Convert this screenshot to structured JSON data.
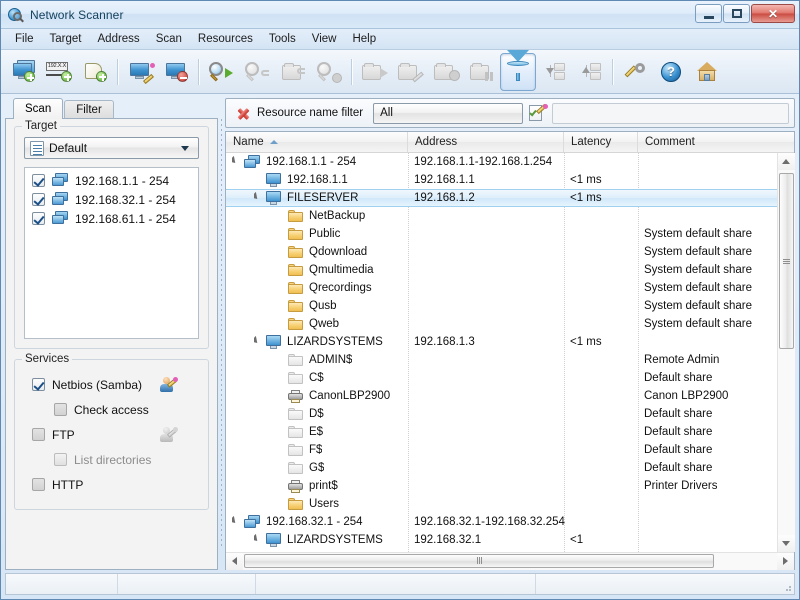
{
  "window": {
    "title": "Network Scanner",
    "app_icon": "network-scanner-icon",
    "minimize_label": "",
    "maximize_label": "",
    "close_label": "✕"
  },
  "menubar": {
    "items": [
      {
        "label": "File"
      },
      {
        "label": "Target"
      },
      {
        "label": "Address"
      },
      {
        "label": "Scan"
      },
      {
        "label": "Resources"
      },
      {
        "label": "Tools"
      },
      {
        "label": "View"
      },
      {
        "label": "Help"
      }
    ]
  },
  "toolbar": {
    "buttons": [
      {
        "name": "add-computer-button",
        "icon": "computer-add-icon",
        "enabled": true,
        "pressed": false
      },
      {
        "name": "add-ip-range-button",
        "icon": "ip-range-add-icon",
        "enabled": true,
        "pressed": false,
        "ip_text": "192.X.X"
      },
      {
        "name": "add-list-button",
        "icon": "list-add-icon",
        "enabled": true,
        "pressed": false
      },
      {
        "name": "edit-computer-button",
        "icon": "computer-edit-icon",
        "enabled": true,
        "pressed": false
      },
      {
        "name": "delete-computer-button",
        "icon": "computer-delete-icon",
        "enabled": true,
        "pressed": false
      },
      {
        "name": "start-scan-button",
        "icon": "scan-start-icon",
        "enabled": true,
        "pressed": false
      },
      {
        "name": "rescan-button",
        "icon": "scan-rescan-icon",
        "enabled": false,
        "pressed": false
      },
      {
        "name": "scan-folder-button",
        "icon": "scan-folder-icon",
        "enabled": false,
        "pressed": false
      },
      {
        "name": "stop-scan-button",
        "icon": "scan-stop-icon",
        "enabled": false,
        "pressed": false
      },
      {
        "name": "open-resource-button",
        "icon": "folder-open-icon",
        "enabled": false,
        "pressed": false
      },
      {
        "name": "edit-resource-button",
        "icon": "folder-edit-icon",
        "enabled": false,
        "pressed": false
      },
      {
        "name": "remove-resource-button",
        "icon": "folder-remove-icon",
        "enabled": false,
        "pressed": false
      },
      {
        "name": "map-resource-button",
        "icon": "folder-map-icon",
        "enabled": false,
        "pressed": false
      },
      {
        "name": "filter-button",
        "icon": "funnel-filter-icon",
        "enabled": true,
        "pressed": true
      },
      {
        "name": "collapse-all-button",
        "icon": "tree-collapse-icon",
        "enabled": false,
        "pressed": false
      },
      {
        "name": "expand-all-button",
        "icon": "tree-expand-icon",
        "enabled": false,
        "pressed": false
      },
      {
        "name": "options-button",
        "icon": "wrench-options-icon",
        "enabled": true,
        "pressed": false
      },
      {
        "name": "help-button",
        "icon": "help-question-icon",
        "enabled": true,
        "pressed": false
      },
      {
        "name": "home-button",
        "icon": "home-icon",
        "enabled": true,
        "pressed": false
      }
    ]
  },
  "left_panel": {
    "tabs": [
      {
        "label": "Scan",
        "active": true
      },
      {
        "label": "Filter",
        "active": false
      }
    ],
    "target_group": {
      "legend": "Target",
      "profile_combo": {
        "value": "Default",
        "icon": "document-list-icon"
      },
      "targets": [
        {
          "label": "192.168.1.1 - 254",
          "checked": true
        },
        {
          "label": "192.168.32.1 - 254",
          "checked": true
        },
        {
          "label": "192.168.61.1 - 254",
          "checked": true
        }
      ]
    },
    "services_group": {
      "legend": "Services",
      "items": [
        {
          "label": "Netbios (Samba)",
          "checked": true,
          "enabled": true,
          "indent": false,
          "icon": "user-credentials-icon",
          "icon_enabled": true
        },
        {
          "label": "Check access",
          "checked": false,
          "enabled": true,
          "indent": true,
          "icon": null,
          "icon_enabled": false
        },
        {
          "label": "FTP",
          "checked": false,
          "enabled": true,
          "indent": false,
          "icon": "user-credentials-icon",
          "icon_enabled": false
        },
        {
          "label": "List directories",
          "checked": false,
          "enabled": false,
          "indent": true,
          "icon": null,
          "icon_enabled": false
        },
        {
          "label": "HTTP",
          "checked": false,
          "enabled": true,
          "indent": false,
          "icon": null,
          "icon_enabled": false
        }
      ]
    }
  },
  "filter_bar": {
    "clear_icon": "red-x-icon",
    "label": "Resource name filter",
    "combo_value": "All",
    "edit_icon": "edit-filter-icon",
    "text_value": "",
    "text_placeholder": ""
  },
  "grid": {
    "columns": [
      {
        "label": "Name",
        "sorted": true,
        "sort_dir": "asc"
      },
      {
        "label": "Address",
        "sorted": false
      },
      {
        "label": "Latency",
        "sorted": false
      },
      {
        "label": "Comment",
        "sorted": false
      }
    ],
    "rows": [
      {
        "indent": 0,
        "icon": "network-range-icon",
        "expander": "open",
        "name": "192.168.1.1 - 254",
        "address": "192.168.1.1-192.168.1.254",
        "latency": "",
        "comment": "",
        "selected": false
      },
      {
        "indent": 1,
        "icon": "computer-icon",
        "expander": "none",
        "name": "192.168.1.1",
        "address": "192.168.1.1",
        "latency": "<1 ms",
        "comment": "",
        "selected": false
      },
      {
        "indent": 1,
        "icon": "computer-icon",
        "expander": "open",
        "name": "FILESERVER",
        "address": "192.168.1.2",
        "latency": "<1 ms",
        "comment": "",
        "selected": true
      },
      {
        "indent": 2,
        "icon": "folder-icon",
        "expander": "none",
        "name": "NetBackup",
        "address": "",
        "latency": "",
        "comment": "",
        "selected": false
      },
      {
        "indent": 2,
        "icon": "folder-icon",
        "expander": "none",
        "name": "Public",
        "address": "",
        "latency": "",
        "comment": "System default share",
        "selected": false
      },
      {
        "indent": 2,
        "icon": "folder-icon",
        "expander": "none",
        "name": "Qdownload",
        "address": "",
        "latency": "",
        "comment": "System default share",
        "selected": false
      },
      {
        "indent": 2,
        "icon": "folder-icon",
        "expander": "none",
        "name": "Qmultimedia",
        "address": "",
        "latency": "",
        "comment": "System default share",
        "selected": false
      },
      {
        "indent": 2,
        "icon": "folder-icon",
        "expander": "none",
        "name": "Qrecordings",
        "address": "",
        "latency": "",
        "comment": "System default share",
        "selected": false
      },
      {
        "indent": 2,
        "icon": "folder-icon",
        "expander": "none",
        "name": "Qusb",
        "address": "",
        "latency": "",
        "comment": "System default share",
        "selected": false
      },
      {
        "indent": 2,
        "icon": "folder-icon",
        "expander": "none",
        "name": "Qweb",
        "address": "",
        "latency": "",
        "comment": "System default share",
        "selected": false
      },
      {
        "indent": 1,
        "icon": "computer-icon",
        "expander": "open",
        "name": "LIZARDSYSTEMS",
        "address": "192.168.1.3",
        "latency": "<1 ms",
        "comment": "",
        "selected": false
      },
      {
        "indent": 2,
        "icon": "folder-hidden-icon",
        "expander": "none",
        "name": "ADMIN$",
        "address": "",
        "latency": "",
        "comment": "Remote Admin",
        "selected": false
      },
      {
        "indent": 2,
        "icon": "folder-hidden-icon",
        "expander": "none",
        "name": "C$",
        "address": "",
        "latency": "",
        "comment": "Default share",
        "selected": false
      },
      {
        "indent": 2,
        "icon": "printer-icon",
        "expander": "none",
        "name": "CanonLBP2900",
        "address": "",
        "latency": "",
        "comment": "Canon LBP2900",
        "selected": false
      },
      {
        "indent": 2,
        "icon": "folder-hidden-icon",
        "expander": "none",
        "name": "D$",
        "address": "",
        "latency": "",
        "comment": "Default share",
        "selected": false
      },
      {
        "indent": 2,
        "icon": "folder-hidden-icon",
        "expander": "none",
        "name": "E$",
        "address": "",
        "latency": "",
        "comment": "Default share",
        "selected": false
      },
      {
        "indent": 2,
        "icon": "folder-hidden-icon",
        "expander": "none",
        "name": "F$",
        "address": "",
        "latency": "",
        "comment": "Default share",
        "selected": false
      },
      {
        "indent": 2,
        "icon": "folder-hidden-icon",
        "expander": "none",
        "name": "G$",
        "address": "",
        "latency": "",
        "comment": "Default share",
        "selected": false
      },
      {
        "indent": 2,
        "icon": "printer-icon",
        "expander": "none",
        "name": "print$",
        "address": "",
        "latency": "",
        "comment": "Printer Drivers",
        "selected": false
      },
      {
        "indent": 2,
        "icon": "folder-icon",
        "expander": "none",
        "name": "Users",
        "address": "",
        "latency": "",
        "comment": "",
        "selected": false
      },
      {
        "indent": 0,
        "icon": "network-range-icon",
        "expander": "open",
        "name": "192.168.32.1 - 254",
        "address": "192.168.32.1-192.168.32.254",
        "latency": "",
        "comment": "",
        "selected": false
      },
      {
        "indent": 1,
        "icon": "computer-icon",
        "expander": "open",
        "name": "LIZARDSYSTEMS",
        "address": "192.168.32.1",
        "latency": "<1",
        "comment": "",
        "selected": false
      }
    ]
  },
  "statusbar": {
    "cells": [
      "",
      "",
      "",
      ""
    ]
  }
}
